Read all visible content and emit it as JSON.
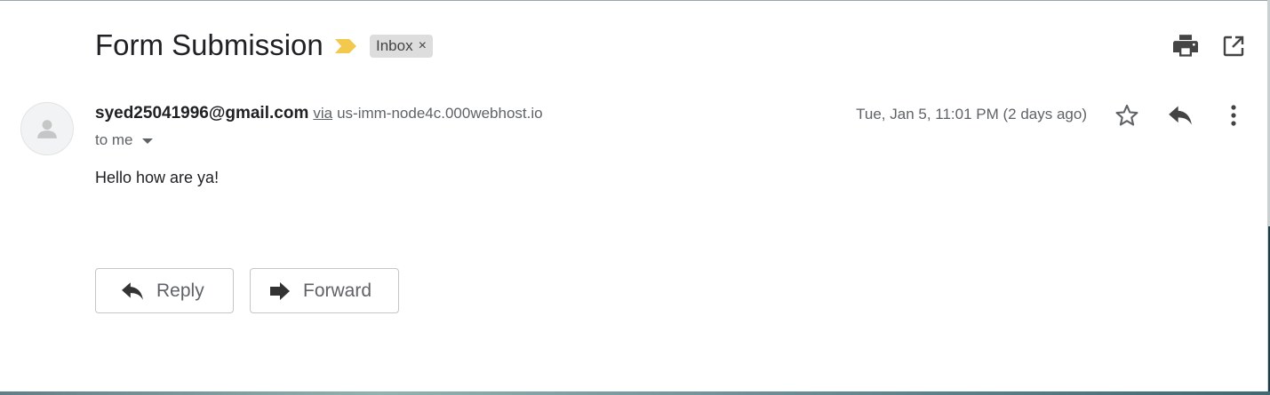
{
  "email": {
    "subject": "Form Submission",
    "label": "Inbox",
    "label_remove": "×",
    "sender_email": "syed25041996@gmail.com",
    "via_label": "via",
    "via_host": "us-imm-node4c.000webhost.io",
    "recipient": "to me",
    "date": "Tue, Jan 5, 11:01 PM (2 days ago)",
    "body": "Hello how are ya!"
  },
  "actions": {
    "reply_label": "Reply",
    "forward_label": "Forward"
  },
  "icons": {
    "importance": "importance-marker-icon",
    "print": "print-icon",
    "open_new_window": "open-in-new-window-icon",
    "star": "star-icon",
    "reply": "reply-icon",
    "more": "more-vertical-icon",
    "avatar": "person-icon",
    "forward": "forward-icon"
  },
  "colors": {
    "importance_marker": "#f2c94c",
    "label_chip_bg": "#dddddd",
    "secondary_text": "#5f6368",
    "primary_text": "#202124"
  }
}
